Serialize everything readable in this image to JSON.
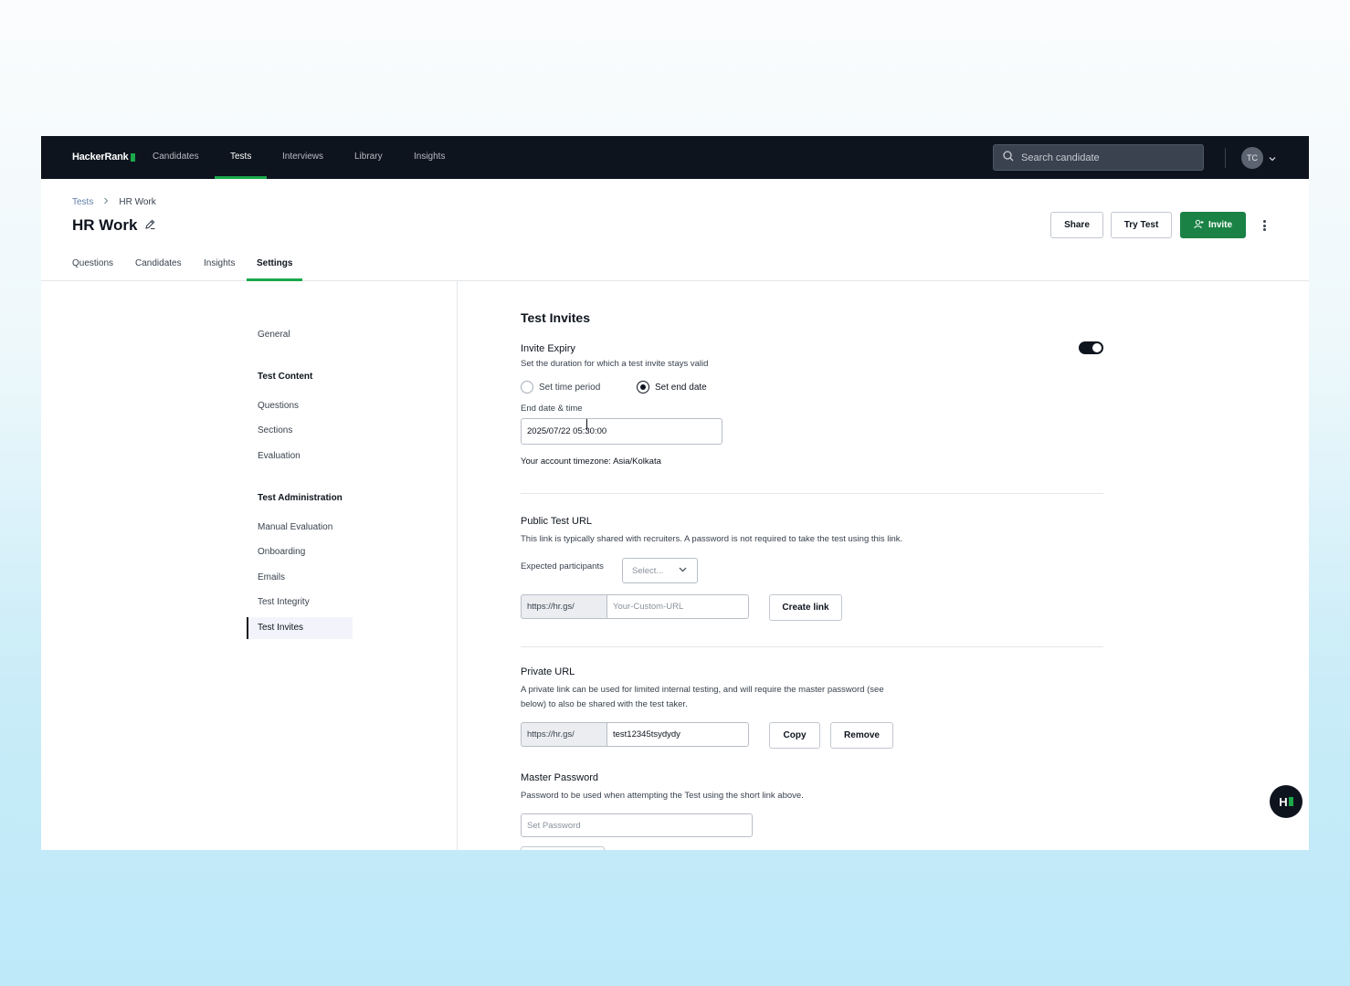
{
  "nav": {
    "logo": "HackerRank",
    "links": [
      "Candidates",
      "Tests",
      "Interviews",
      "Library",
      "Insights"
    ],
    "active": "Tests",
    "search_placeholder": "Search candidate",
    "avatar_initials": "TC"
  },
  "breadcrumb": {
    "parent": "Tests",
    "current": "HR Work"
  },
  "page_title": "HR Work",
  "actions": {
    "share": "Share",
    "try_test": "Try Test",
    "invite": "Invite"
  },
  "tabs": [
    "Questions",
    "Candidates",
    "Insights",
    "Settings"
  ],
  "active_tab": "Settings",
  "sidebar": {
    "general": "General",
    "test_content_heading": "Test Content",
    "test_content_items": [
      "Questions",
      "Sections",
      "Evaluation"
    ],
    "test_admin_heading": "Test Administration",
    "test_admin_items": [
      "Manual Evaluation",
      "Onboarding",
      "Emails",
      "Test Integrity",
      "Test Invites"
    ],
    "active_item": "Test Invites"
  },
  "main": {
    "section_title": "Test Invites",
    "invite_expiry": {
      "label": "Invite Expiry",
      "description": "Set the duration for which a test invite stays valid",
      "enabled": true,
      "option_time_period": "Set time period",
      "option_end_date": "Set end date",
      "selected": "Set end date",
      "end_date_label": "End date & time",
      "end_date_value": "2025/07/22 05:30:00",
      "timezone_prefix": "Your account timezone:",
      "timezone_value": "Asia/Kolkata"
    },
    "public_url": {
      "label": "Public Test URL",
      "description": "This link is typically shared with recruiters. A password is not required to take the test using this link.",
      "participants_label": "Expected participants",
      "participants_placeholder": "Select...",
      "prefix": "https://hr.gs/",
      "placeholder": "Your-Custom-URL",
      "create_button": "Create link"
    },
    "private_url": {
      "label": "Private URL",
      "description_line1": "A private link can be used for limited internal testing, and will require the master password (see",
      "description_line2": "below) to also be shared with the test taker.",
      "prefix": "https://hr.gs/",
      "value": "test12345tsydydy",
      "copy_button": "Copy",
      "remove_button": "Remove"
    },
    "master_password": {
      "label": "Master Password",
      "description": "Password to be used when attempting the Test using the short link above.",
      "placeholder": "Set Password"
    }
  },
  "colors": {
    "nav_bg": "#0e141e",
    "accent_green": "#1ba94c",
    "invite_button": "#1a8245"
  },
  "help_button_label": "H"
}
